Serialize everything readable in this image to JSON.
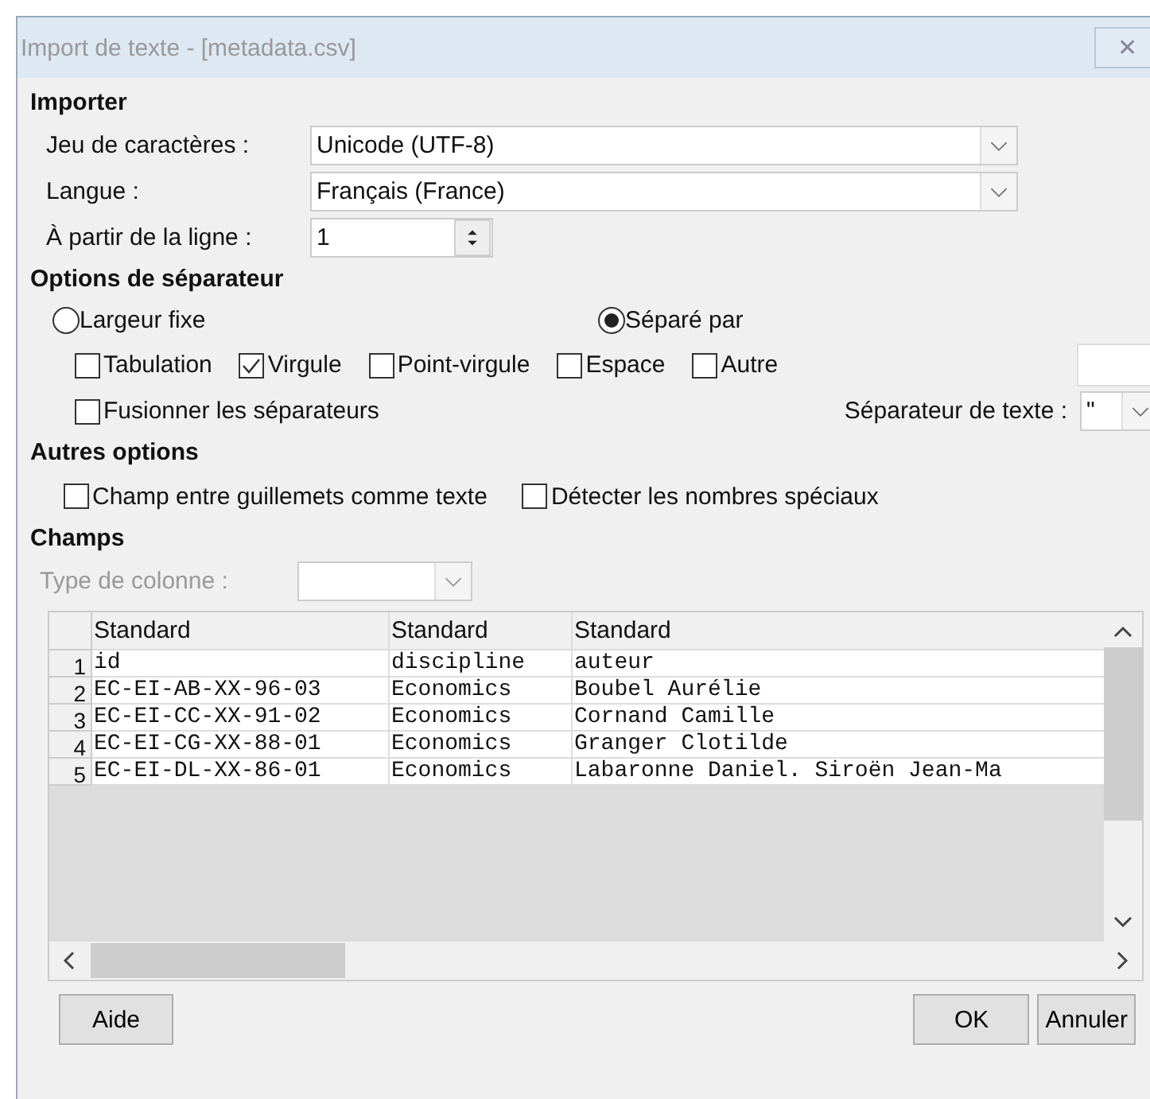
{
  "window": {
    "title": "Import de texte - [metadata.csv]",
    "close": "✕"
  },
  "import": {
    "heading": "Importer",
    "charset": {
      "label": "Jeu de caractères :",
      "value": "Unicode (UTF-8)"
    },
    "language": {
      "label": "Langue :",
      "value": "Français (France)"
    },
    "from_line": {
      "label": "À partir de la ligne :",
      "value": "1"
    }
  },
  "separator_options": {
    "heading": "Options de séparateur",
    "modes": [
      {
        "label": "Largeur fixe",
        "selected": false
      },
      {
        "label": "Séparé par",
        "selected": true
      }
    ],
    "separators": [
      {
        "label": "Tabulation",
        "checked": false
      },
      {
        "label": "Virgule",
        "checked": true
      },
      {
        "label": "Point-virgule",
        "checked": false
      },
      {
        "label": "Espace",
        "checked": false
      },
      {
        "label": "Autre",
        "checked": false
      }
    ],
    "merge": {
      "label": "Fusionner les séparateurs",
      "checked": false
    },
    "text_delimiter": {
      "label": "Séparateur de texte :",
      "value": "\""
    }
  },
  "other_options": {
    "heading": "Autres options",
    "items": [
      {
        "label": "Champ entre guillemets comme texte",
        "checked": false
      },
      {
        "label": "Détecter les nombres spéciaux",
        "checked": false
      }
    ]
  },
  "fields": {
    "heading": "Champs",
    "column_type": {
      "label": "Type de colonne :",
      "disabled": true
    },
    "columns": [
      "Standard",
      "Standard",
      "Standard"
    ],
    "rows": [
      {
        "number": "1",
        "cells": [
          "id",
          "discipline",
          "auteur"
        ]
      },
      {
        "number": "2",
        "cells": [
          "EC-EI-AB-XX-96-03",
          "Economics",
          "Boubel Aurélie"
        ]
      },
      {
        "number": "3",
        "cells": [
          "EC-EI-CC-XX-91-02",
          "Economics",
          "Cornand Camille"
        ]
      },
      {
        "number": "4",
        "cells": [
          "EC-EI-CG-XX-88-01",
          "Economics",
          "Granger Clotilde"
        ]
      },
      {
        "number": "5",
        "cells": [
          "EC-EI-DL-XX-86-01",
          "Economics",
          "Labaronne Daniel. Siroën Jean-Ma"
        ]
      }
    ]
  },
  "buttons": {
    "help": "Aide",
    "ok": "OK",
    "cancel": "Annuler"
  }
}
